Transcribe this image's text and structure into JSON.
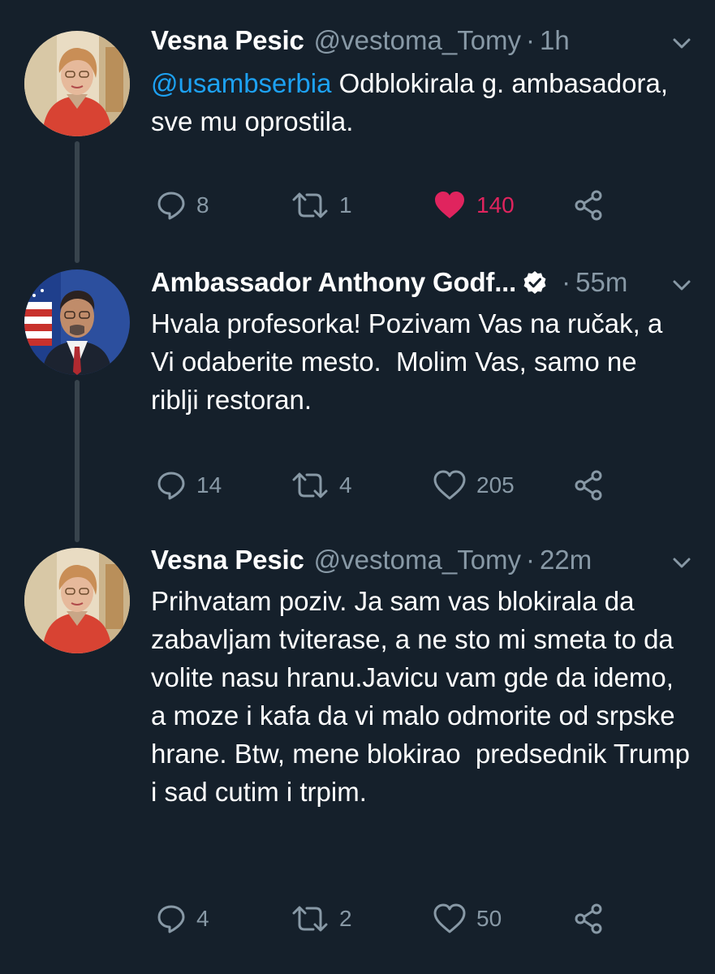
{
  "tweets": [
    {
      "name": "Vesna Pesic",
      "handle": "@vestoma_Tomy",
      "separator": "·",
      "time": "1h",
      "mention": "@usambserbia",
      "text": " Odblokirala g. ambasadora, sve mu oprostila.",
      "replies": "8",
      "retweets": "1",
      "likes": "140",
      "liked": true
    },
    {
      "name": "Ambassador Anthony Godf...",
      "verified": true,
      "separator": "·",
      "time": "55m",
      "text": "Hvala profesorka! Pozivam Vas na ručak, a Vi odaberite mesto.  Molim Vas, samo ne riblji restoran.",
      "replies": "14",
      "retweets": "4",
      "likes": "205",
      "liked": false
    },
    {
      "name": "Vesna Pesic",
      "handle": "@vestoma_Tomy",
      "separator": "·",
      "time": "22m",
      "text": "Prihvatam poziv. Ja sam vas blokirala da zabavljam tviterase, a ne sto mi smeta to da volite nasu hranu.Javicu vam gde da idemo, a moze i kafa da vi malo odmorite od srpske hrane. Btw, mene blokirao  predsednik Trump i sad cutim i trpim.",
      "replies": "4",
      "retweets": "2",
      "likes": "50",
      "liked": false
    }
  ],
  "colors": {
    "background": "#15202b",
    "secondary_text": "#8899a6",
    "link": "#1da1f2",
    "like_active": "#e0245e",
    "thread_line": "#38444d"
  },
  "icons": {
    "reply": "speech-bubble-icon",
    "retweet": "retweet-arrows-icon",
    "like": "heart-icon",
    "share": "share-icon",
    "more": "chevron-down-icon",
    "verified": "verified-badge-icon"
  }
}
